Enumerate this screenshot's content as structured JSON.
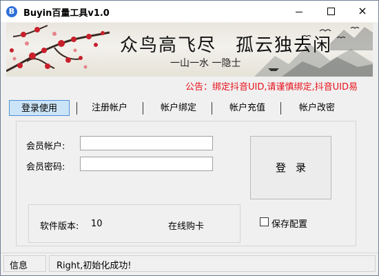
{
  "window": {
    "title": "Buyin百量工具v1.0",
    "icon_letter": "B",
    "controls": {
      "minimize": "minimize-icon",
      "maximize": "maximize-icon",
      "close": "×"
    }
  },
  "banner": {
    "slogan": "众鸟高飞尽　孤云独去闲",
    "sub": "一山一水 一隐士",
    "image": "plum-blossom-painting"
  },
  "notice": "公告：绑定抖音UID,请谨慎绑定,抖音UID易",
  "tabs": [
    {
      "label": "登录使用",
      "active": true
    },
    {
      "label": "注册帐户",
      "active": false
    },
    {
      "label": "帐户绑定",
      "active": false
    },
    {
      "label": "帐户充值",
      "active": false
    },
    {
      "label": "帐户改密",
      "active": false
    }
  ],
  "form": {
    "account_label": "会员帐户:",
    "account_value": "",
    "password_label": "会员密码:",
    "password_value": "",
    "login_button": "登录",
    "version_label": "软件版本:",
    "version_value": "10",
    "buy_online": "在线购卡",
    "save_config": "保存配置",
    "save_config_checked": false
  },
  "statusbar": {
    "label": "信息",
    "message": "Right,初始化成功!"
  },
  "colors": {
    "notice_red": "#e8111a",
    "tab_active_bg": "#cce4f7",
    "tab_active_border": "#4a90d9",
    "app_icon_blue": "#2f6fd8"
  }
}
